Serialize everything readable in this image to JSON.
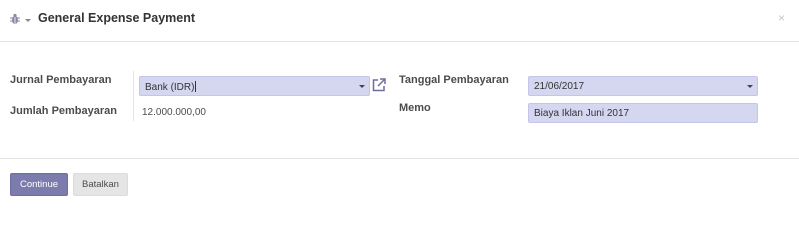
{
  "dialog": {
    "title": "General Expense Payment",
    "close_glyph": "×"
  },
  "form": {
    "journal": {
      "label": "Jurnal Pembayaran",
      "value": "Bank (IDR)"
    },
    "amount": {
      "label": "Jumlah Pembayaran",
      "value": "12.000.000,00"
    },
    "date": {
      "label": "Tanggal Pembayaran",
      "value": "21/06/2017"
    },
    "memo": {
      "label": "Memo",
      "value": "Biaya Iklan Juni 2017"
    }
  },
  "footer": {
    "continue_label": "Continue",
    "cancel_label": "Batalkan"
  },
  "colors": {
    "field_bg": "#d5d6f0",
    "primary_button": "#7c7bad",
    "secondary_button": "#e5e5e5"
  },
  "icons": {
    "menu": "bug-icon",
    "external": "external-link-icon",
    "close": "close-icon"
  }
}
